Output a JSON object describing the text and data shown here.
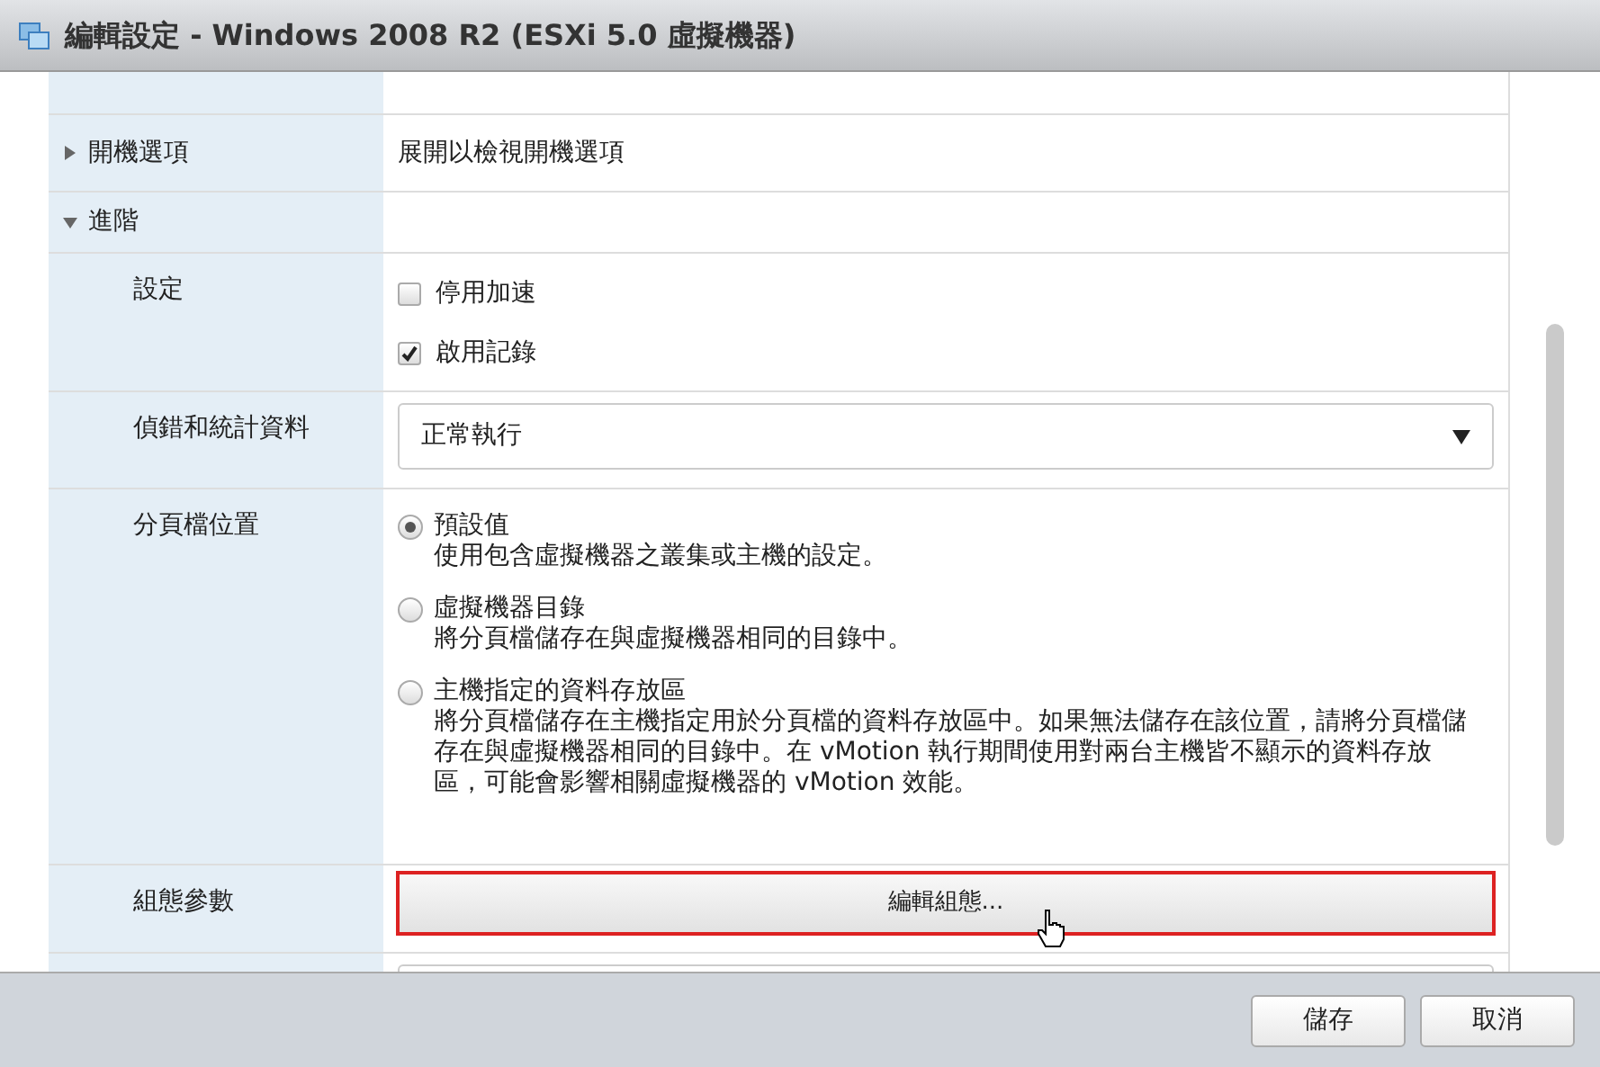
{
  "window": {
    "title": "編輯設定 - Windows 2008 R2 (ESXi 5.0 虛擬機器)"
  },
  "sections": [
    {
      "label": "開機選項",
      "expanded": false,
      "summary": "展開以檢視開機選項"
    },
    {
      "label": "進階",
      "expanded": true
    }
  ],
  "settings": [
    {
      "kind": "checkboxes",
      "label": "設定",
      "options": [
        {
          "label": "停用加速",
          "checked": false
        },
        {
          "label": "啟用記錄",
          "checked": true
        }
      ]
    },
    {
      "kind": "dropdown",
      "label": "偵錯和統計資料",
      "value": "正常執行"
    },
    {
      "kind": "radios",
      "label": "分頁檔位置",
      "options": [
        {
          "label": "預設值",
          "description": "使用包含虛擬機器之叢集或主機的設定。",
          "selected": true
        },
        {
          "label": "虛擬機器目錄",
          "description": "將分頁檔儲存在與虛擬機器相同的目錄中。",
          "selected": false
        },
        {
          "label": "主機指定的資料存放區",
          "description": "將分頁檔儲存在主機指定用於分頁檔的資料存放區中。如果無法儲存在該位置，請將分頁檔儲存在與虛擬機器相同的目錄中。在 vMotion 執行期間使用對兩台主機皆不顯示的資料存放區，可能會影響相關虛擬機器的 vMotion 效能。",
          "selected": false
        }
      ]
    },
    {
      "kind": "button",
      "label": "組態參數",
      "button": "編輯組態...",
      "highlighted": true
    }
  ],
  "footer": {
    "buttons": [
      "儲存",
      "取消"
    ]
  }
}
